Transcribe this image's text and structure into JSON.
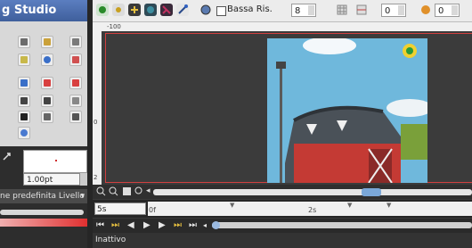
{
  "app_title": "g Studio",
  "left_panel": {
    "outline_width": "1.00pt",
    "layer_preset_label": "ne predefinita Livello"
  },
  "toolbar": {
    "low_res_label": "Bassa Ris.",
    "quality_value": "8",
    "field_a_value": "0",
    "field_b_value": "0"
  },
  "ruler": {
    "top_label": "-100",
    "left_labels": [
      "0",
      "2"
    ]
  },
  "timeline": {
    "current_time": "5s",
    "tick_labels": [
      "0f",
      "2s"
    ]
  },
  "status": {
    "text": "Inattivo"
  },
  "colors": {
    "title_bar": "#4a6fb0",
    "accent_red": "#d04040",
    "scroll_thumb": "#7aa7d8"
  },
  "icons": {
    "toolbar": [
      "render-settings-icon",
      "render-preview-icon",
      "tools-icon",
      "onion-skin-icon",
      "keyframe-lock-icon",
      "animation-mode-icon"
    ],
    "transport": [
      "seek-begin-icon",
      "prev-keyframe-icon",
      "prev-frame-icon",
      "play-icon",
      "next-frame-icon",
      "next-keyframe-icon",
      "seek-end-icon"
    ]
  }
}
